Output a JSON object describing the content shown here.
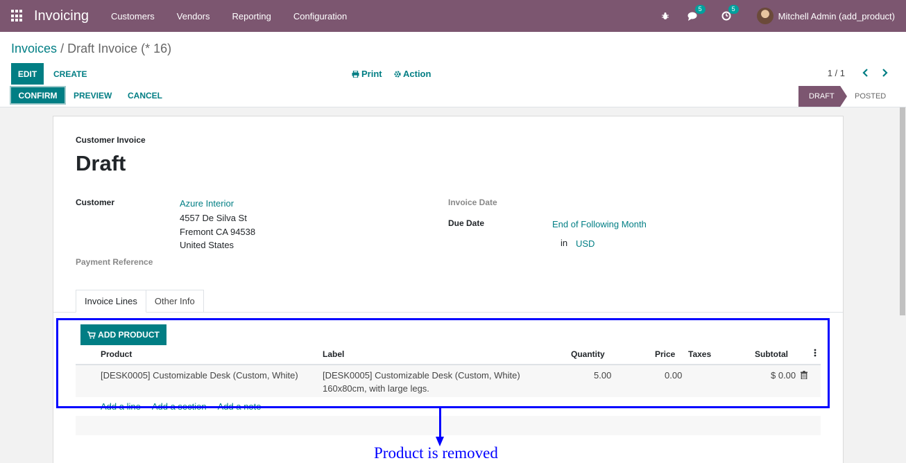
{
  "navbar": {
    "app_title": "Invoicing",
    "menu": [
      "Customers",
      "Vendors",
      "Reporting",
      "Configuration"
    ],
    "messages_badge": "5",
    "activities_badge": "5",
    "user_name": "Mitchell Admin (add_product)",
    "icons": [
      "apps-icon",
      "bug-icon",
      "chat-icon",
      "clock-icon"
    ]
  },
  "control_panel": {
    "breadcrumb_root": "Invoices",
    "breadcrumb_sep": "/",
    "breadcrumb_current": "Draft Invoice (* 16)",
    "edit_label": "EDIT",
    "create_label": "CREATE",
    "print_label": "Print",
    "action_label": "Action",
    "pager": "1 / 1"
  },
  "statusbar": {
    "confirm_label": "CONFIRM",
    "preview_label": "PREVIEW",
    "cancel_label": "CANCEL",
    "stages": [
      "DRAFT",
      "POSTED"
    ],
    "active_stage": "DRAFT"
  },
  "form": {
    "type_label": "Customer Invoice",
    "status_title": "Draft",
    "customer_label": "Customer",
    "customer_name": "Azure Interior",
    "address_line1": "4557 De Silva St",
    "address_line2": "Fremont CA 94538",
    "address_line3": "United States",
    "payment_ref_label": "Payment Reference",
    "invoice_date_label": "Invoice Date",
    "due_date_label": "Due Date",
    "due_date_value": "End of Following Month",
    "currency_prefix": "in",
    "currency": "USD",
    "tabs": [
      "Invoice Lines",
      "Other Info"
    ],
    "add_product_label": "ADD PRODUCT",
    "columns": [
      "Product",
      "Label",
      "Quantity",
      "Price",
      "Taxes",
      "Subtotal"
    ],
    "line": {
      "product": "[DESK0005] Customizable Desk (Custom, White)",
      "label_line1": "[DESK0005] Customizable Desk (Custom, White)",
      "label_line2": "160x80cm, with large legs.",
      "quantity": "5.00",
      "price": "0.00",
      "taxes": "",
      "subtotal": "$ 0.00"
    },
    "add_line": "Add a line",
    "add_section": "Add a section",
    "add_note": "Add a note"
  },
  "annotation": {
    "text": "Product is removed",
    "color": "#0000ff"
  },
  "colors": {
    "brand": "#7c5670",
    "accent": "#017e84"
  }
}
